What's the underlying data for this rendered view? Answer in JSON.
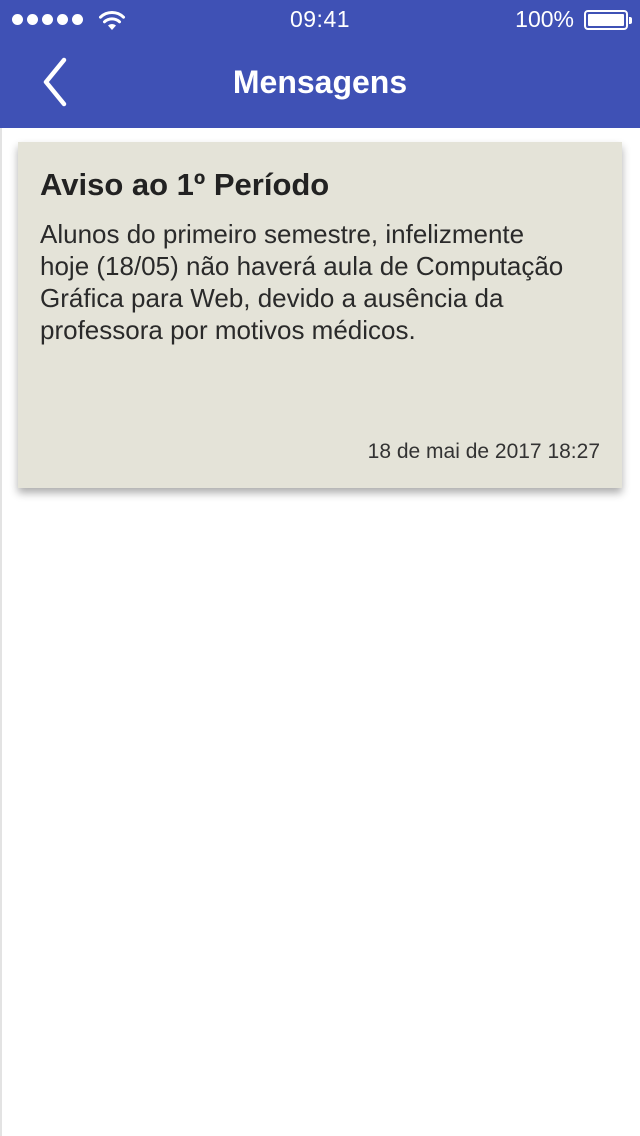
{
  "status_bar": {
    "time": "09:41",
    "battery_percent": "100%",
    "signal_bars": 5,
    "battery_level": 1.0
  },
  "header": {
    "title": "Mensagens",
    "background_color": "#3f51b5",
    "back_icon": "chevron-left-icon"
  },
  "messages": [
    {
      "title": "Aviso ao 1º Período",
      "body": "Alunos do primeiro semestre, infelizmente hoje (18/05) não haverá aula de Computação Gráfica para Web, devido a ausência da professora por motivos médicos.",
      "date": "18 de mai de 2017 18:27",
      "background_color": "#e4e3d8"
    }
  ]
}
